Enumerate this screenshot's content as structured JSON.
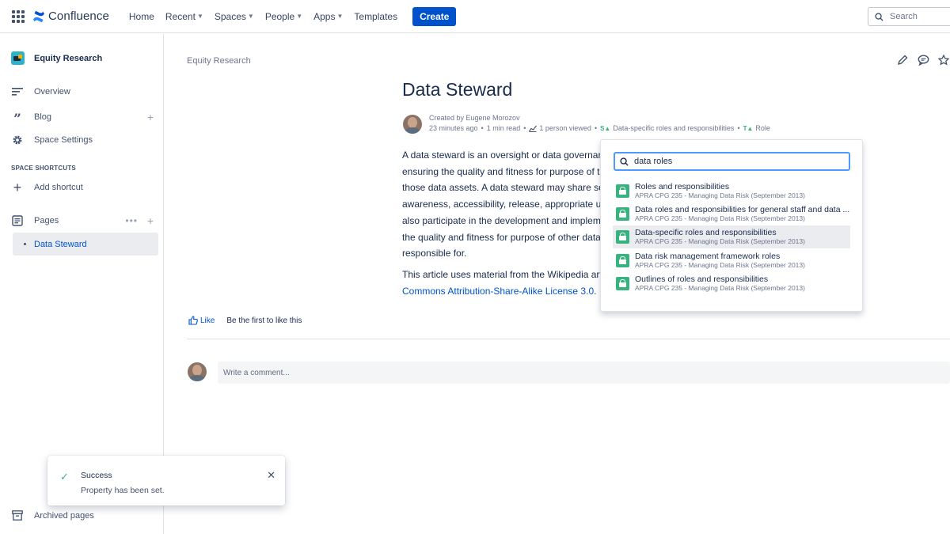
{
  "nav": {
    "product": "Confluence",
    "items": [
      {
        "label": "Home",
        "dropdown": false
      },
      {
        "label": "Recent",
        "dropdown": true
      },
      {
        "label": "Spaces",
        "dropdown": true
      },
      {
        "label": "People",
        "dropdown": true
      },
      {
        "label": "Apps",
        "dropdown": true
      },
      {
        "label": "Templates",
        "dropdown": false
      }
    ],
    "create_label": "Create",
    "search_placeholder": "Search"
  },
  "sidebar": {
    "space_name": "Equity Research",
    "overview": "Overview",
    "blog": "Blog",
    "space_settings": "Space Settings",
    "shortcuts_heading": "SPACE SHORTCUTS",
    "add_shortcut": "Add shortcut",
    "pages": "Pages",
    "current_page": "Data Steward",
    "archived": "Archived pages"
  },
  "page": {
    "breadcrumb": "Equity Research",
    "title": "Data Steward",
    "created_by": "Created by Eugene Morozov",
    "time_ago": "23 minutes ago",
    "read_time": "1 min read",
    "views": "1 person viewed",
    "property_1": "Data-specific roles and responsibilities",
    "property_2": "Role",
    "body_lines": [
      "A data steward is an oversight or data governan",
      "ensuring the quality and fitness for purpose of t",
      "those data assets. A data steward may share sor",
      "awareness, accessibility, release, appropriate use",
      "also participate in the development and implem",
      "the quality and fitness for purpose of other data",
      "responsible for."
    ],
    "attrib_line1": "This article uses material from the Wikipedia arti",
    "attrib_link": "Commons Attribution-Share-Alike License 3.0",
    "attrib_end": ".",
    "like_label": "Like",
    "like_message": "Be the first to like this",
    "comment_placeholder": "Write a comment..."
  },
  "popup": {
    "query": "data roles",
    "results": [
      {
        "title": "Roles and responsibilities",
        "subtitle": "APRA CPG 235 - Managing Data Risk (September 2013)",
        "active": false
      },
      {
        "title": "Data roles and responsibilities for general staff and data ...",
        "subtitle": "APRA CPG 235 - Managing Data Risk (September 2013)",
        "active": false
      },
      {
        "title": "Data-specific roles and responsibilities",
        "subtitle": "APRA CPG 235 - Managing Data Risk (September 2013)",
        "active": true
      },
      {
        "title": "Data risk management framework roles",
        "subtitle": "APRA CPG 235 - Managing Data Risk (September 2013)",
        "active": false
      },
      {
        "title": "Outlines of roles and responsibilities",
        "subtitle": "APRA CPG 235 - Managing Data Risk (September 2013)",
        "active": false
      }
    ]
  },
  "toast": {
    "title": "Success",
    "message": "Property has been set."
  },
  "colors": {
    "brand": "#0052cc",
    "success": "#36b37e",
    "focus": "#4c9aff"
  }
}
